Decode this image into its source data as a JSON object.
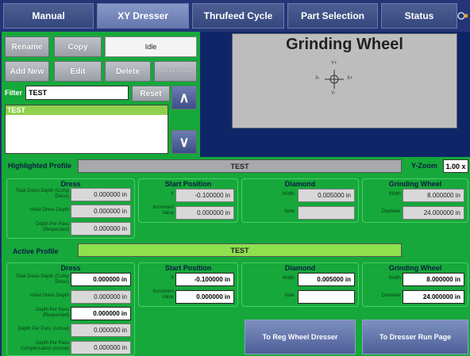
{
  "tabs": [
    {
      "label": "Manual"
    },
    {
      "label": "XY Dresser"
    },
    {
      "label": "Thrufeed Cycle"
    },
    {
      "label": "Part Selection"
    },
    {
      "label": "Status"
    }
  ],
  "toolbar": {
    "rename": "Rename",
    "copy": "Copy",
    "state": "Idle",
    "add_new": "Add New",
    "edit": "Edit",
    "delete": "Delete",
    "disabled_btn": "Set As Active",
    "filter_label": "Filter",
    "filter_value": "TEST",
    "reset": "Reset",
    "up_arrow": "∧",
    "down_arrow": "∨"
  },
  "profile_list": [
    "TEST"
  ],
  "preview": {
    "title": "Grinding Wheel",
    "axis_yplus": "Y+",
    "axis_yminus": "Y-",
    "axis_xminus": "X-",
    "axis_xplus": "X+"
  },
  "highlighted": {
    "label": "Highlighted Profile",
    "name": "TEST",
    "yzoom_label": "Y-Zoom",
    "yzoom_value": "1.00 x",
    "dress": {
      "title": "Dress",
      "total_label": "Total Dress Depth (Comp Dress)",
      "total_value": "0.000000 in",
      "initial_label": "Initial Dress Depth",
      "initial_value": "0.000000 in",
      "perpass_label": "Depth Per Pass (Requested)",
      "perpass_value": "0.000000 in"
    },
    "start": {
      "title": "Start Position",
      "x_label": "X",
      "x_value": "-0.100000 in",
      "inc_label": "Increment Value",
      "inc_value": "0.000000 in"
    },
    "diamond": {
      "title": "Diamond",
      "width_label": "Width",
      "width_value": "0.005000 in",
      "note_label": "Note",
      "note_value": ""
    },
    "wheel": {
      "title": "Grinding Wheel",
      "width_label": "Width",
      "width_value": "8.000000 in",
      "diameter_label": "Diameter",
      "diameter_value": "24.000000 in"
    }
  },
  "active": {
    "label": "Active Profile",
    "name": "TEST",
    "dress": {
      "title": "Dress",
      "total_label": "Total Dress Depth (Comp Dress)",
      "total_value": "0.000000 in",
      "initial_label": "Initial Dress Depth",
      "initial_value": "0.000000 in",
      "perpass_label": "Depth Per Pass (Requested)",
      "perpass_value": "0.000000 in",
      "actual_label": "Depth Per Pass (Actual)",
      "actual_value": "0.000000 in",
      "comp_label": "Depth Per Pass Compensation (Actual)",
      "comp_value": "0.000000 in"
    },
    "start": {
      "title": "Start Position",
      "x_label": "X",
      "x_value": "-0.100000 in",
      "inc_label": "Increment Value",
      "inc_value": "0.000000 in"
    },
    "diamond": {
      "title": "Diamond",
      "width_label": "Width",
      "width_value": "0.005000 in",
      "note_label": "Note",
      "note_value": ""
    },
    "wheel": {
      "title": "Grinding Wheel",
      "width_label": "Width",
      "width_value": "8.000000 in",
      "diameter_label": "Diameter",
      "diameter_value": "24.000000 in"
    }
  },
  "actions": {
    "reg_wheel": "To Reg Wheel Dresser",
    "run_page": "To Dresser Run Page"
  },
  "colors": {
    "background": "#0e2668",
    "green": "#16a83a",
    "highlight_bar": "#a7a9ad",
    "active_bar": "#8fe04e",
    "list_selection": "#8fd14f"
  }
}
